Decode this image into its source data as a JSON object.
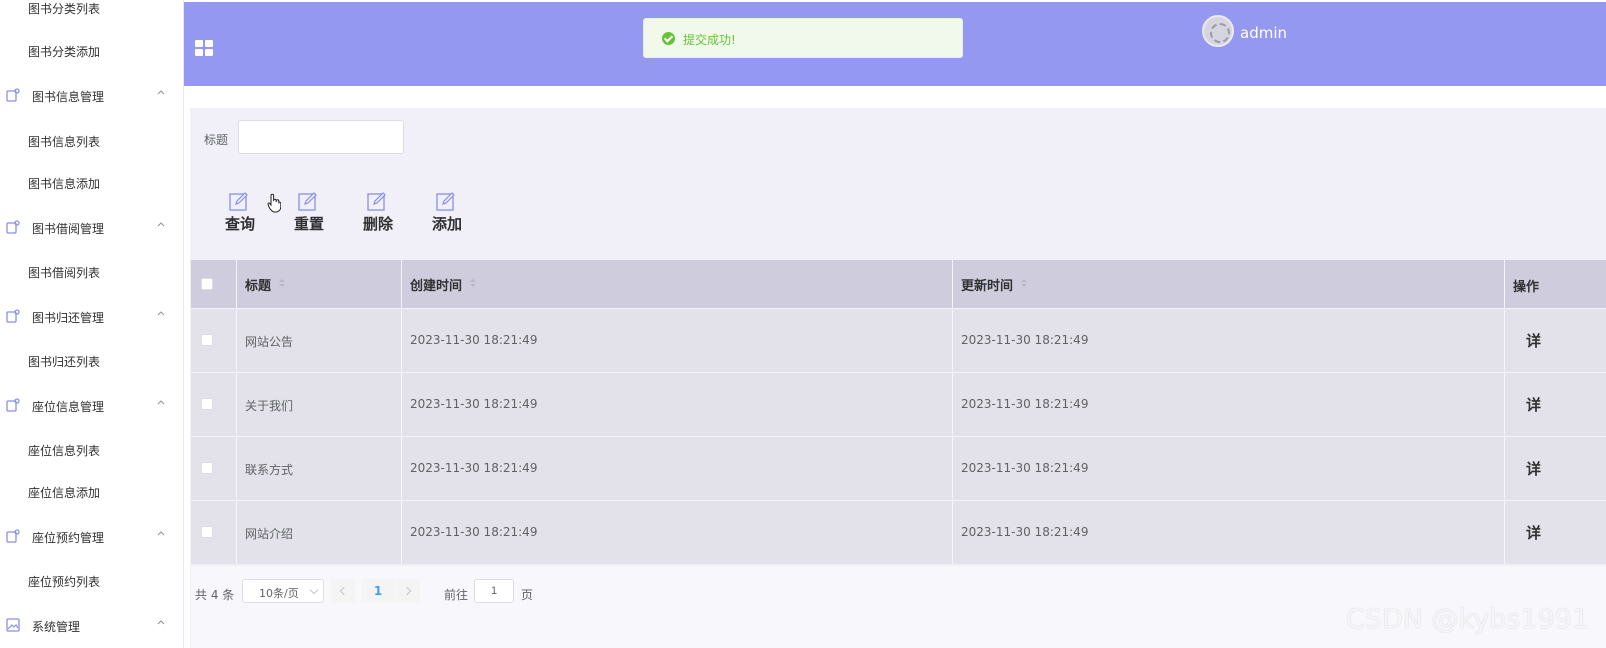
{
  "sidebar": {
    "items": [
      {
        "type": "item",
        "label": "图书分类列表"
      },
      {
        "type": "item",
        "label": "图书分类添加"
      },
      {
        "type": "group",
        "label": "图书信息管理"
      },
      {
        "type": "item",
        "label": "图书信息列表"
      },
      {
        "type": "item",
        "label": "图书信息添加"
      },
      {
        "type": "group",
        "label": "图书借阅管理"
      },
      {
        "type": "item",
        "label": "图书借阅列表"
      },
      {
        "type": "group",
        "label": "图书归还管理"
      },
      {
        "type": "item",
        "label": "图书归还列表"
      },
      {
        "type": "group",
        "label": "座位信息管理"
      },
      {
        "type": "item",
        "label": "座位信息列表"
      },
      {
        "type": "item",
        "label": "座位信息添加"
      },
      {
        "type": "group",
        "label": "座位预约管理"
      },
      {
        "type": "item",
        "label": "座位预约列表"
      },
      {
        "type": "group",
        "label": "系统管理"
      }
    ]
  },
  "header": {
    "username": "admin",
    "toast": "提交成功!",
    "background": "#9598f1"
  },
  "search": {
    "label": "标题",
    "value": "",
    "placeholder": ""
  },
  "toolbar": {
    "query": "查询",
    "reset": "重置",
    "delete": "删除",
    "add": "添加"
  },
  "table": {
    "headers": {
      "title": "标题",
      "created": "创建时间",
      "updated": "更新时间",
      "action": "操作"
    },
    "rows": [
      {
        "title": "网站公告",
        "created": "2023-11-30 18:21:49",
        "updated": "2023-11-30 18:21:49",
        "action": "详"
      },
      {
        "title": "关于我们",
        "created": "2023-11-30 18:21:49",
        "updated": "2023-11-30 18:21:49",
        "action": "详"
      },
      {
        "title": "联系方式",
        "created": "2023-11-30 18:21:49",
        "updated": "2023-11-30 18:21:49",
        "action": "详"
      },
      {
        "title": "网站介绍",
        "created": "2023-11-30 18:21:49",
        "updated": "2023-11-30 18:21:49",
        "action": "详"
      }
    ]
  },
  "pagination": {
    "total": "共 4 条",
    "page_size": "10条/页",
    "current": "1",
    "goto_label": "前往",
    "goto_value": "1",
    "page_suffix": "页"
  },
  "watermark": "CSDN @kybs1991"
}
